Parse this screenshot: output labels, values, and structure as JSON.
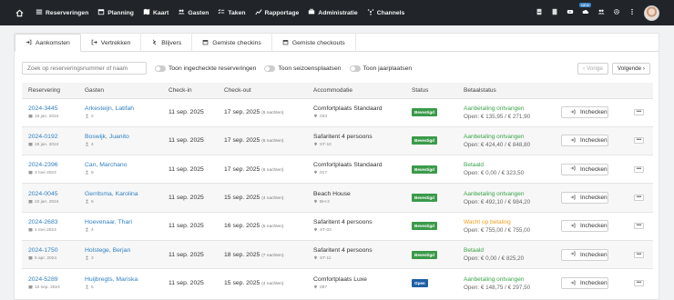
{
  "nav": {
    "items": [
      {
        "label": "Reserveringen",
        "icon": "list-icon"
      },
      {
        "label": "Planning",
        "icon": "calendar-icon"
      },
      {
        "label": "Kaart",
        "icon": "map-icon"
      },
      {
        "label": "Gasten",
        "icon": "users-icon"
      },
      {
        "label": "Taken",
        "icon": "tasks-icon"
      },
      {
        "label": "Rapportage",
        "icon": "chart-icon"
      },
      {
        "label": "Administratie",
        "icon": "admin-icon"
      },
      {
        "label": "Channels",
        "icon": "channels-icon"
      }
    ],
    "new_badge": "NEW"
  },
  "tabs": [
    {
      "label": "Aankomsten",
      "icon": "arrival-icon"
    },
    {
      "label": "Vertrekken",
      "icon": "departure-icon"
    },
    {
      "label": "Blijvers",
      "icon": "stay-icon"
    },
    {
      "label": "Gemiste checkins",
      "icon": "calendar-icon"
    },
    {
      "label": "Gemiste checkouts",
      "icon": "calendar-icon"
    }
  ],
  "filters": {
    "search_placeholder": "Zoek op reserveringsnummer of naam",
    "toggle1": "Toon ingecheckte reserveringen",
    "toggle2": "Toon seizoensplaatsen",
    "toggle3": "Toon jaarplaatsen",
    "prev": "‹ Vorige",
    "next": "Volgende ›"
  },
  "table": {
    "headers": [
      "Reservering",
      "Gasten",
      "Check-in",
      "Check-out",
      "Accommodatie",
      "Status",
      "Betaalstatus"
    ],
    "checkin_label": "Inchecken",
    "rows": [
      {
        "code": "2024-3445",
        "date": "16 jan. 2024",
        "guest": "Arkesteijn, Latifah",
        "count": "2",
        "checkin": "11 sep. 2025",
        "checkout": "17 sep. 2025",
        "nights": "(6 nachten)",
        "acc": "Comfortplaats Standaard",
        "loc": "033",
        "status": "Bevestigd",
        "pay": "Aanbetaling ontvangen",
        "paycolor": "#3aa34a",
        "open": "Open: € 135,95 / € 271,90"
      },
      {
        "code": "2024-0192",
        "date": "18 jan. 2024",
        "guest": "Boswijk, Juanito",
        "count": "4",
        "checkin": "11 sep. 2025",
        "checkout": "17 sep. 2025",
        "nights": "(6 nachten)",
        "acc": "Safaritent 4 persoons",
        "loc": "ST-10",
        "status": "Bevestigd",
        "pay": "Aanbetaling ontvangen",
        "paycolor": "#3aa34a",
        "open": "Open: € 424,40 / € 848,80"
      },
      {
        "code": "2024-2396",
        "date": "3 mei 2024",
        "guest": "Can, Marchano",
        "count": "5",
        "checkin": "11 sep. 2025",
        "checkout": "17 sep. 2025",
        "nights": "(6 nachten)",
        "acc": "Comfortplaats Standaard",
        "loc": "017",
        "status": "Bevestigd",
        "pay": "Betaald",
        "paycolor": "#3aa34a",
        "open": "Open: € 0,00 / € 323,50"
      },
      {
        "code": "2024-0045",
        "date": "22 jan. 2024",
        "guest": "Gerritsma, Karolina",
        "count": "5",
        "checkin": "11 sep. 2025",
        "checkout": "15 sep. 2025",
        "nights": "(4 nachten)",
        "acc": "Beach House",
        "loc": "BH-2",
        "status": "Bevestigd",
        "pay": "Aanbetaling ontvangen",
        "paycolor": "#3aa34a",
        "open": "Open: € 492,10 / € 984,20"
      },
      {
        "code": "2024-2683",
        "date": "1 mei 2024",
        "guest": "Hoevenaar, Thari",
        "count": "4",
        "checkin": "11 sep. 2025",
        "checkout": "16 sep. 2025",
        "nights": "(5 nachten)",
        "acc": "Safaritent 4 persoons",
        "loc": "ST-03",
        "status": "Bevestigd",
        "pay": "Wacht op betaling",
        "paycolor": "#f0a020",
        "open": "Open: € 755,00 / € 755,00"
      },
      {
        "code": "2024-1750",
        "date": "6 apr. 2024",
        "guest": "Holstege, Berjan",
        "count": "3",
        "checkin": "11 sep. 2025",
        "checkout": "18 sep. 2025",
        "nights": "(7 nachten)",
        "acc": "Safaritent 4 persoons",
        "loc": "ST-11",
        "status": "Bevestigd",
        "pay": "Betaald",
        "paycolor": "#3aa34a",
        "open": "Open: € 0,00 / € 825,20"
      },
      {
        "code": "2024-5289",
        "date": "10 sep. 2024",
        "guest": "Huijbregts, Mariska",
        "count": "5",
        "checkin": "11 sep. 2025",
        "checkout": "15 sep. 2025",
        "nights": "(4 nachten)",
        "acc": "Comfortplaats Luxe",
        "loc": "087",
        "status": "Open",
        "pay": "Aanbetaling ontvangen",
        "paycolor": "#3aa34a",
        "open": "Open: € 148,75 / € 297,50"
      }
    ]
  },
  "colors": {
    "confirmed": "#3a9a4a",
    "open": "#1f5fa6",
    "link": "#2f7fc1"
  }
}
